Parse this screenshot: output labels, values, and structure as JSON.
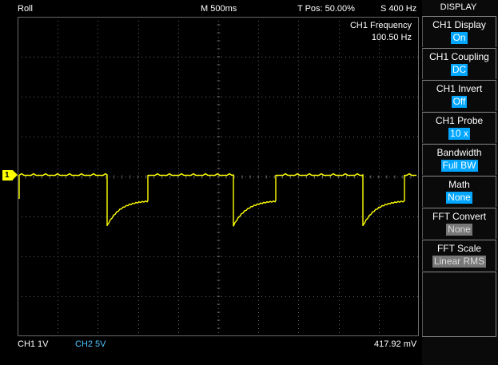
{
  "header": {
    "mode": "Roll",
    "timebase": "M 500ms",
    "trigger_position": "T Pos: 50.00%",
    "sample_rate": "S 400 Hz"
  },
  "measurement": {
    "label": "CH1 Frequency",
    "value": "100.50 Hz"
  },
  "channel_marker": "1",
  "footer": {
    "ch1": "CH1  1V",
    "ch2": "CH2  5V",
    "reading": "417.92 mV"
  },
  "menu": {
    "title": "DISPLAY",
    "items": [
      {
        "label": "CH1 Display",
        "value": "On",
        "active": true
      },
      {
        "label": "CH1 Coupling",
        "value": "DC",
        "active": true
      },
      {
        "label": "CH1 Invert",
        "value": "Off",
        "active": true
      },
      {
        "label": "CH1 Probe",
        "value": "10 x",
        "active": true
      },
      {
        "label": "Bandwidth",
        "value": "Full BW",
        "active": true
      },
      {
        "label": "Math",
        "value": "None",
        "active": true
      },
      {
        "label": "FFT Convert",
        "value": "None",
        "active": false
      },
      {
        "label": "FFT Scale",
        "value": "Linear RMS",
        "active": false
      }
    ]
  },
  "colors": {
    "trace": "#ffff00",
    "grid": "#6a6a6a",
    "ch2": "#4fc4ff",
    "menu_active": "#00a6ff",
    "menu_disabled": "#777777"
  }
}
